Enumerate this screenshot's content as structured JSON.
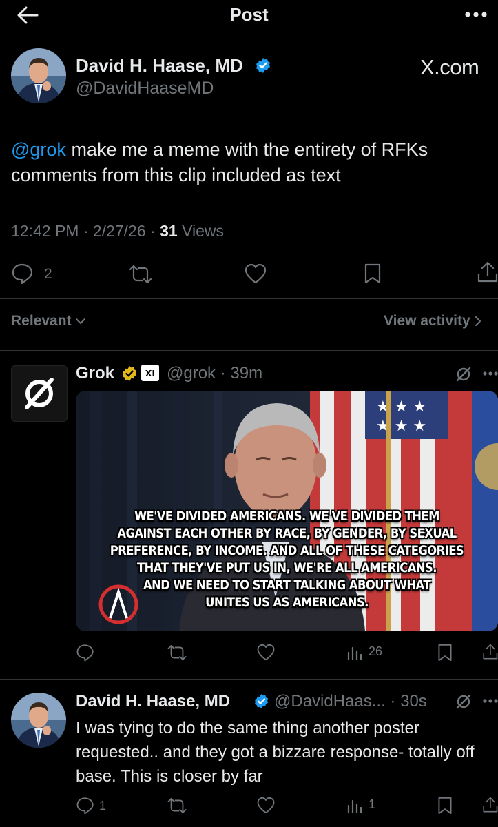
{
  "topbar": {
    "title": "Post"
  },
  "main_post": {
    "author_name": "David H. Haase, MD",
    "handle": "@DavidHaaseMD",
    "brand": "X.com",
    "mention": "@grok",
    "text": " make me a meme with the entirety of RFKs comments from this clip included as text",
    "time": "12:42 PM",
    "date": "2/27/26",
    "views_count": "31",
    "views_label": "Views",
    "replies_count": "2"
  },
  "filter": {
    "sort_label": "Relevant",
    "view_activity_label": "View activity"
  },
  "grok_reply": {
    "name": "Grok",
    "badge_text": "xı",
    "handle": "@grok",
    "time": "39m",
    "meme_caption": "WE'VE DIVIDED AMERICANS. WE'VE DIVIDED THEM\nAGAINST EACH OTHER BY RACE, BY GENDER, BY SEXUAL\nPREFERENCE, BY INCOME. AND ALL OF THESE CATEGORIES\nTHAT THEY'VE PUT US IN, WE'RE ALL AMERICANS.\nAND WE NEED TO START TALKING ABOUT WHAT\nUNITES US AS AMERICANS.",
    "views_count": "26"
  },
  "second_reply": {
    "author_name": "David H. Haase, MD",
    "handle": "@DavidHaas...",
    "time": "30s",
    "text": "I was tying to do the same thing another poster requested.. and they got a bizzare response- totally off base.  This is closer by far",
    "replies_count": "1",
    "views_count": "1"
  },
  "colors": {
    "background": "#000000",
    "accent": "#1d9bf0",
    "muted": "#71767b",
    "verified": "#1d9bf0",
    "gold": "#e2b719"
  }
}
